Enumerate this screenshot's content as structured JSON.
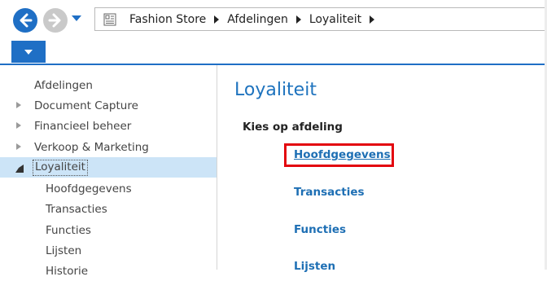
{
  "address_bar": {
    "breadcrumbs": [
      "Fashion Store",
      "Afdelingen",
      "Loyaliteit"
    ]
  },
  "left_nav": {
    "header": "Afdelingen",
    "items": [
      {
        "label": "Document Capture",
        "expandable": true,
        "expanded": false
      },
      {
        "label": "Financieel beheer",
        "expandable": true,
        "expanded": false
      },
      {
        "label": "Verkoop & Marketing",
        "expandable": true,
        "expanded": false
      },
      {
        "label": "Loyaliteit",
        "expandable": true,
        "expanded": true,
        "selected": true
      }
    ],
    "children": [
      "Hoofdgegevens",
      "Transacties",
      "Functies",
      "Lijsten",
      "Historie"
    ]
  },
  "main": {
    "title": "Loyaliteit",
    "section_label": "Kies op afdeling",
    "links": [
      "Hoofdgegevens",
      "Transacties",
      "Functies",
      "Lijsten"
    ],
    "highlighted_link": "Hoofdgegevens"
  },
  "colors": {
    "accent": "#1f6fc5",
    "link": "#1e6fb4",
    "selection": "#cce4f7",
    "highlight_box": "#e3060f"
  }
}
